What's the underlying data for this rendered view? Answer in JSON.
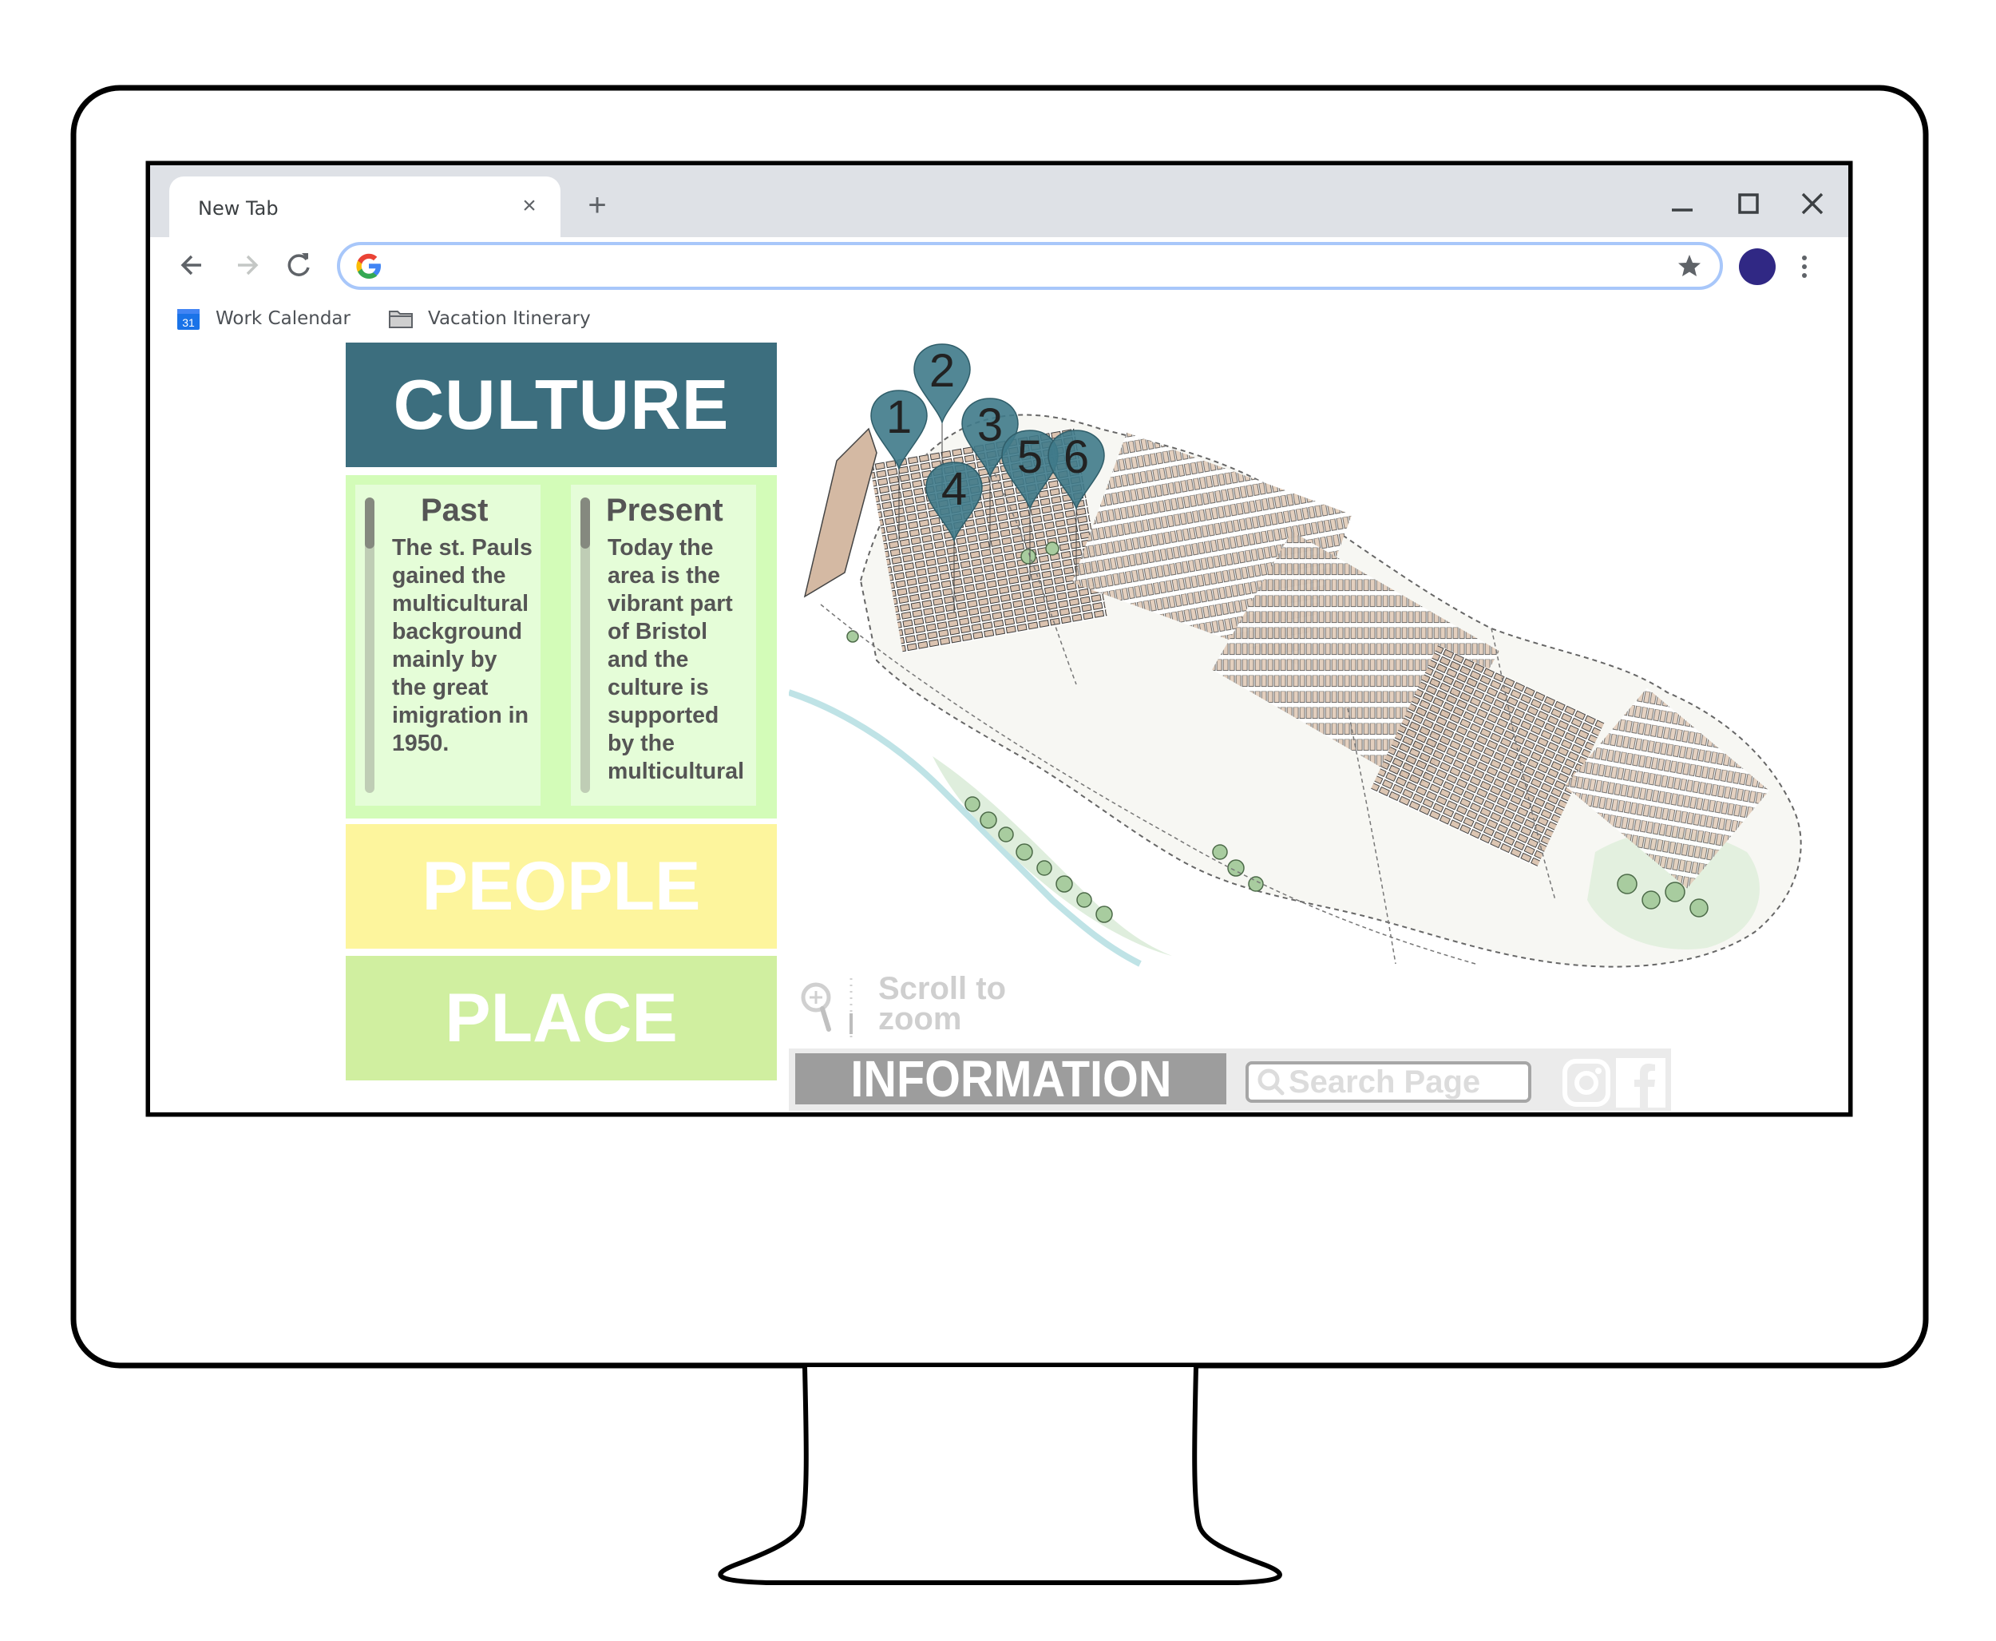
{
  "browser": {
    "tab_title": "New Tab",
    "tab_close_icon": "close-icon",
    "new_tab_icon": "plus-icon",
    "window_controls": [
      "minimize-icon",
      "maximize-icon",
      "close-icon"
    ],
    "nav": [
      "back-icon",
      "forward-icon",
      "reload-icon"
    ],
    "address_value": "",
    "avatar_color": "#302884",
    "bookmarks": [
      {
        "label": "Work Calendar",
        "icon": "calendar-icon",
        "icon_text": "31"
      },
      {
        "label": "Vacation Itinerary",
        "icon": "folder-icon"
      }
    ]
  },
  "page": {
    "culture": {
      "title": "CULTURE",
      "color": "#3c6e7e",
      "past": {
        "heading": "Past",
        "text": "The st. Pauls\ngained the\nmulticultural\nbackground\nmainly  by\nthe great\nimigration in\n1950."
      },
      "present": {
        "heading": "Present",
        "text": "Today the\narea is the\nvibrant part\nof Bristol\nand the\nculture is\nsupported\nby the\nmulticultural"
      }
    },
    "people": {
      "title": "PEOPLE",
      "color": "#fdf59d"
    },
    "place": {
      "title": "PLACE",
      "color": "#d0efa0"
    },
    "map": {
      "pins": [
        "1",
        "2",
        "3",
        "4",
        "5",
        "6"
      ],
      "pin_color": "#3f7a8a"
    },
    "scroll_hint": "Scroll to\nzoom",
    "info_bar": {
      "information_label": "INFORMATION",
      "search_placeholder": "Search Page",
      "social": [
        "instagram-icon",
        "facebook-icon"
      ]
    }
  }
}
